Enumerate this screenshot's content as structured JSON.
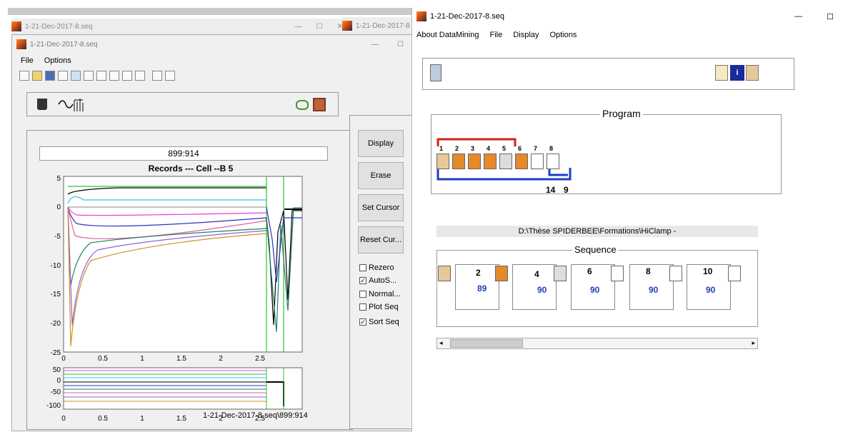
{
  "back_window": {
    "title": "1-21-Dec-2017-8.seq"
  },
  "middle_window": {
    "title": "1-21-Dec-2017-8"
  },
  "left_window": {
    "title": "1-21-Dec-2017-8.seq",
    "menu": [
      "File",
      "Options"
    ],
    "value_display": "899:914",
    "plot_title": "Records --- Cell --B 5",
    "buttons": [
      "Display",
      "Erase",
      "Set Cursor",
      "Reset Cur..."
    ],
    "checkboxes": [
      {
        "label": "Rezero",
        "checked": false
      },
      {
        "label": "AutoS...",
        "checked": true
      },
      {
        "label": "Normal...",
        "checked": false
      },
      {
        "label": "Plot Seq",
        "checked": false
      },
      {
        "label": "Sort Seq",
        "checked": true
      }
    ],
    "bottom_label": "1-21-Dec-2017-8.seq\\899:914"
  },
  "main_plot": {
    "xticks": [
      "0",
      "0.5",
      "1",
      "1.5",
      "2",
      "2.5"
    ],
    "yticks": [
      "5",
      "0",
      "-5",
      "-10",
      "-15",
      "-20",
      "-25"
    ]
  },
  "small_plot": {
    "xticks": [
      "0",
      "0.5",
      "1",
      "1.5",
      "2",
      "2.5"
    ],
    "yticks": [
      "50",
      "0",
      "-50",
      "-100"
    ]
  },
  "right_window": {
    "title": "1-21-Dec-2017-8.seq",
    "menu": [
      "About DataMining",
      "File",
      "Display",
      "Options"
    ],
    "program_label": "Program",
    "program_numbers": [
      "1",
      "2",
      "3",
      "4",
      "5",
      "6",
      "7",
      "8"
    ],
    "loop_counts": [
      "14",
      "9"
    ],
    "path": "D:\\Thèse SPIDERBEE\\Formations\\HiClamp -",
    "sequence_label": "Sequence",
    "seq_numbers": [
      "2",
      "4",
      "6",
      "8",
      "10"
    ],
    "seq_values": [
      "89",
      "90",
      "90",
      "90",
      "90"
    ]
  },
  "colors": {
    "orange_icon": "#e58a2a",
    "blue_num": "#1f3fb5",
    "loop_red": "#d02020",
    "loop_blue": "#1e3ec8"
  }
}
